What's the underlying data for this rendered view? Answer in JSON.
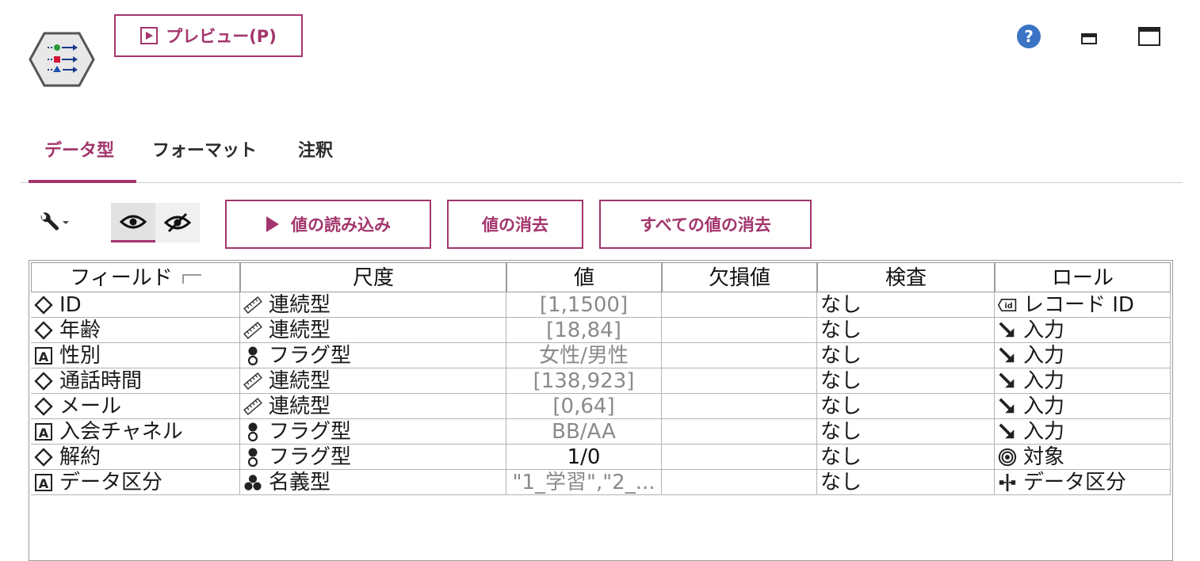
{
  "header": {
    "preview_label": "プレビュー(P)"
  },
  "tabs": [
    "データ型",
    "フォーマット",
    "注釈"
  ],
  "toolbar": {
    "read_values_label": "値の読み込み",
    "clear_values_label": "値の消去",
    "clear_all_values_label": "すべての値の消去"
  },
  "table": {
    "columns": [
      "フィールド",
      "尺度",
      "値",
      "欠損値",
      "検査",
      "ロール"
    ],
    "rows": [
      {
        "field": "ID",
        "field_icon": "continuous-icon",
        "measure": "連続型",
        "measure_icon": "ruler-icon",
        "values": "[1,1500]",
        "missing": "",
        "check": "なし",
        "role": "レコード ID",
        "role_icon": "record-id-icon"
      },
      {
        "field": "年齢",
        "field_icon": "continuous-icon",
        "measure": "連続型",
        "measure_icon": "ruler-icon",
        "values": "[18,84]",
        "missing": "",
        "check": "なし",
        "role": "入力",
        "role_icon": "input-arrow-icon"
      },
      {
        "field": "性別",
        "field_icon": "string-icon",
        "measure": "フラグ型",
        "measure_icon": "flag-icon",
        "values": "女性/男性",
        "missing": "",
        "check": "なし",
        "role": "入力",
        "role_icon": "input-arrow-icon"
      },
      {
        "field": "通話時間",
        "field_icon": "continuous-icon",
        "measure": "連続型",
        "measure_icon": "ruler-icon",
        "values": "[138,923]",
        "missing": "",
        "check": "なし",
        "role": "入力",
        "role_icon": "input-arrow-icon"
      },
      {
        "field": "メール",
        "field_icon": "continuous-icon",
        "measure": "連続型",
        "measure_icon": "ruler-icon",
        "values": "[0,64]",
        "missing": "",
        "check": "なし",
        "role": "入力",
        "role_icon": "input-arrow-icon"
      },
      {
        "field": "入会チャネル",
        "field_icon": "string-icon",
        "measure": "フラグ型",
        "measure_icon": "flag-icon",
        "values": "BB/AA",
        "missing": "",
        "check": "なし",
        "role": "入力",
        "role_icon": "input-arrow-icon"
      },
      {
        "field": "解約",
        "field_icon": "continuous-icon",
        "measure": "フラグ型",
        "measure_icon": "flag-icon",
        "values": "1/0",
        "values_dark": true,
        "missing": "",
        "check": "なし",
        "role": "対象",
        "role_icon": "target-icon"
      },
      {
        "field": "データ区分",
        "field_icon": "string-icon",
        "measure": "名義型",
        "measure_icon": "nominal-icon",
        "values": "\"1_学習\",\"2_...",
        "missing": "",
        "check": "なし",
        "role": "データ区分",
        "role_icon": "partition-icon"
      }
    ]
  },
  "colors": {
    "accent": "#a3356c",
    "help": "#3b74c4"
  }
}
